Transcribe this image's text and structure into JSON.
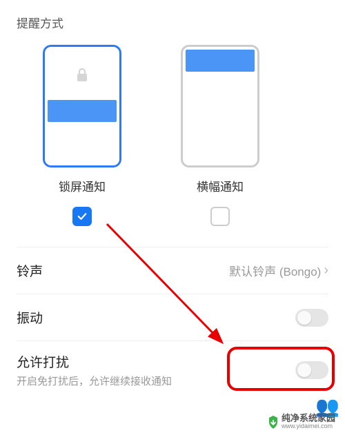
{
  "section_title": "提醒方式",
  "styles": {
    "lock_screen": {
      "label": "锁屏通知",
      "checked": true
    },
    "banner": {
      "label": "横幅通知",
      "checked": false
    }
  },
  "ringtone": {
    "label": "铃声",
    "value": "默认铃声 (Bongo)"
  },
  "vibrate": {
    "label": "振动",
    "enabled": false
  },
  "allow_disturb": {
    "label": "允许打扰",
    "sublabel": "开启免打扰后，允许继续接收通知",
    "enabled": false
  },
  "watermark": {
    "cn": "纯净系统家园",
    "en": "www.yidaimei.com"
  }
}
